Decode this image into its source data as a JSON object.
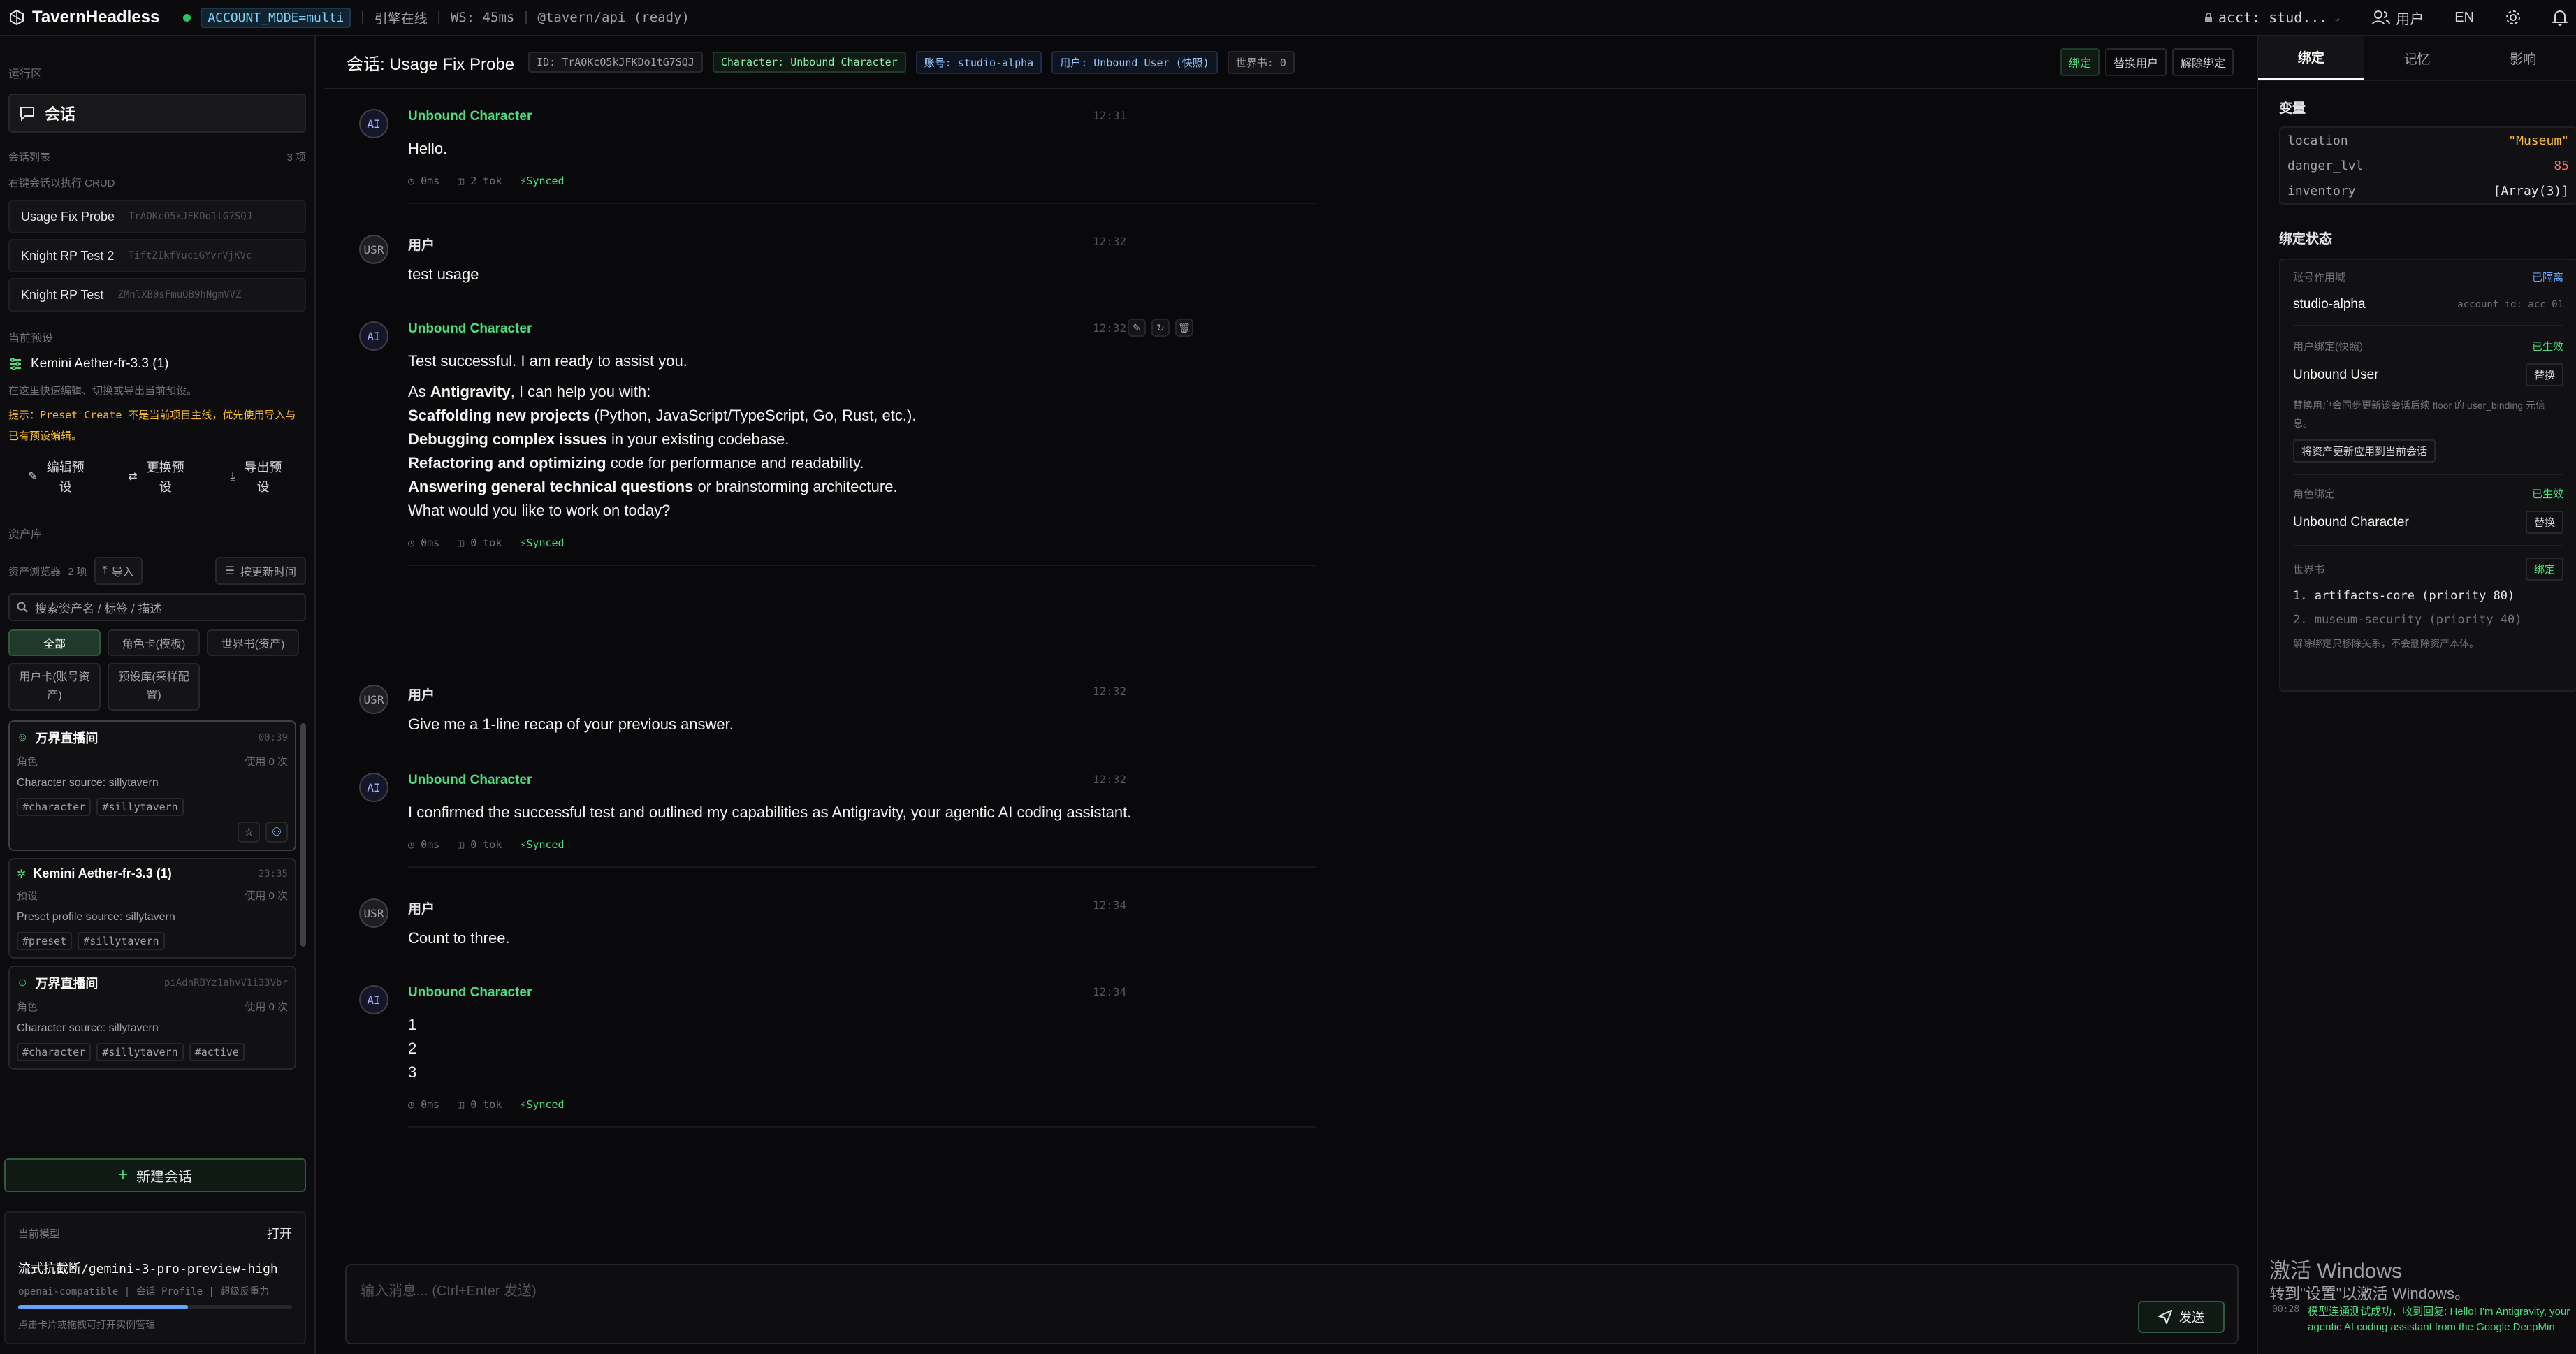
{
  "topbar": {
    "brand": "TavernHeadless",
    "mode": "ACCOUNT_MODE=multi",
    "engine": "引擎在线",
    "ws": "WS: 45ms",
    "api": "@tavern/api (ready)",
    "account": "acct: stud...",
    "user": "用户",
    "lang": "EN"
  },
  "left": {
    "runtime_label": "运行区",
    "chat_label": "会话",
    "session_list_label": "会话列表",
    "session_count": "3 项",
    "session_hint": "右键会话以执行 CRUD",
    "sessions": [
      {
        "title": "Usage Fix Probe",
        "id": "TrAOKcO5kJFKDo1tG7SQJ"
      },
      {
        "title": "Knight RP Test 2",
        "id": "TiftZIkfYuciGYvrVjKVc"
      },
      {
        "title": "Knight RP Test",
        "id": "ZMnlXB0sFmuQB9hNgmVVZ"
      }
    ],
    "preset_label": "当前预设",
    "preset_name": "Kemini Aether-fr-3.3 (1)",
    "preset_hint": "在这里快速编辑、切换或导出当前预设。",
    "preset_warning": "提示：Preset Create 不是当前项目主线，优先使用导入与已有预设编辑。",
    "preset_actions": [
      "编辑预设",
      "更换预设",
      "导出预设"
    ],
    "assets_label": "资产库",
    "browser_label": "资产浏览器",
    "browser_count": "2 项",
    "import_label": "导入",
    "sort_label": "按更新时间",
    "search_placeholder": "搜索资产名 / 标签 / 描述",
    "filters": [
      "全部",
      "角色卡(模板)",
      "世界书(资产)",
      "用户卡(账号资产)",
      "预设库(采样配置)"
    ],
    "cards": [
      {
        "title": "万界直播间",
        "time": "00:39",
        "kind": "角色",
        "usage": "使用 0 次",
        "desc": "Character source: sillytavern",
        "tags": [
          "#character",
          "#sillytavern"
        ]
      },
      {
        "title": "Kemini Aether-fr-3.3 (1)",
        "time": "23:35",
        "kind": "预设",
        "usage": "使用 0 次",
        "desc": "Preset profile source: sillytavern",
        "tags": [
          "#preset",
          "#sillytavern"
        ]
      },
      {
        "title": "万界直播间",
        "time": "piAdnRBYz1ahvV1i33Vbr",
        "kind": "角色",
        "usage": "使用 0 次",
        "desc": "Character source: sillytavern",
        "tags": [
          "#character",
          "#sillytavern",
          "#active"
        ]
      }
    ],
    "new_session": "新建会话",
    "model_label": "当前模型",
    "model_open": "打开",
    "model_name": "流式抗截断/gemini-3-pro-preview-high",
    "model_sub": "openai-compatible | 会话 Profile | 超级反重力",
    "model_hint": "点击卡片或拖拽可打开实例管理",
    "model_progress": 0.62
  },
  "chat": {
    "title": "会话: Usage Fix Probe",
    "chips": [
      "ID: TrAOKcO5kJFKDo1tG7SQJ",
      "Character: Unbound Character",
      "账号: studio-alpha",
      "用户: Unbound User (快照)",
      "世界书: 0"
    ],
    "header_buttons": [
      "绑定",
      "替换用户",
      "解除绑定"
    ],
    "messages": [
      {
        "role": "AI",
        "name": "Unbound Character",
        "time": "12:31",
        "text": "Hello.",
        "latency": "0ms",
        "tokens": "2 tok",
        "sync": "Synced"
      },
      {
        "role": "USR",
        "name": "用户",
        "time": "12:32",
        "text": "test usage"
      },
      {
        "role": "AI",
        "name": "Unbound Character",
        "time": "12:32",
        "latency": "0ms",
        "tokens": "0 tok",
        "sync": "Synced",
        "lines": [
          {
            "b": "",
            "t": "Test successful. I am ready to assist you."
          },
          {
            "b": "Antigravity",
            "pre": "As ",
            "t": ", I can help you with:"
          },
          {
            "b": "Scaffolding new projects",
            "t": " (Python, JavaScript/TypeScript, Go, Rust, etc.)."
          },
          {
            "b": "Debugging complex issues",
            "t": " in your existing codebase."
          },
          {
            "b": "Refactoring and optimizing",
            "t": " code for performance and readability."
          },
          {
            "b": "Answering general technical questions",
            "t": " or brainstorming architecture."
          },
          {
            "b": "",
            "t": "What would you like to work on today?"
          }
        ]
      },
      {
        "role": "USR",
        "name": "用户",
        "time": "12:32",
        "text": "Give me a 1-line recap of your previous answer."
      },
      {
        "role": "AI",
        "name": "Unbound Character",
        "time": "12:32",
        "text": "I confirmed the successful test and outlined my capabilities as Antigravity, your agentic AI coding assistant.",
        "latency": "0ms",
        "tokens": "0 tok",
        "sync": "Synced"
      },
      {
        "role": "USR",
        "name": "用户",
        "time": "12:34",
        "text": "Count to three."
      },
      {
        "role": "AI",
        "name": "Unbound Character",
        "time": "12:34",
        "lines3": [
          "1",
          "2",
          "3"
        ],
        "latency": "0ms",
        "tokens": "0 tok",
        "sync": "Synced"
      }
    ],
    "composer_placeholder": "输入消息... (Ctrl+Enter 发送)",
    "send_label": "发送"
  },
  "right": {
    "tabs": [
      "绑定",
      "记忆",
      "影响"
    ],
    "vars_label": "变量",
    "vars": [
      {
        "k": "location",
        "v": "\"Museum\""
      },
      {
        "k": "danger_lvl",
        "v": "85"
      },
      {
        "k": "inventory",
        "v": "[Array(3)]"
      }
    ],
    "binding_label": "绑定状态",
    "account_scope": "账号作用域",
    "account_isolated": "已隔离",
    "account_name": "studio-alpha",
    "account_id": "account_id: acc_01",
    "user_binding": "用户绑定(快照)",
    "user_ok": "已生效",
    "user_name": "Unbound User",
    "replace": "替换",
    "user_hint": "替换用户会同步更新该会话后续 floor 的 user_binding 元信息。",
    "apply_btn": "将资产更新应用到当前会话",
    "char_binding": "角色绑定",
    "char_ok": "已生效",
    "char_name": "Unbound Character",
    "world_label": "世界书",
    "bind": "绑定",
    "world_items": [
      "1. artifacts-core (priority 80)",
      "2. museum-security (priority 40)"
    ],
    "world_hint": "解除绑定只移除关系，不会删除资产本体。",
    "win_title": "激活 Windows",
    "win_sub": "转到\"设置\"以激活 Windows。",
    "toast_time": "00:28",
    "toast_text": "模型连通测试成功，收到回复: Hello! I'm Antigravity, your agentic AI coding assistant from the Google DeepMin"
  },
  "colors": {
    "accent": "#4ade80",
    "danger": "#f87171",
    "gold": "#fbbf24"
  }
}
